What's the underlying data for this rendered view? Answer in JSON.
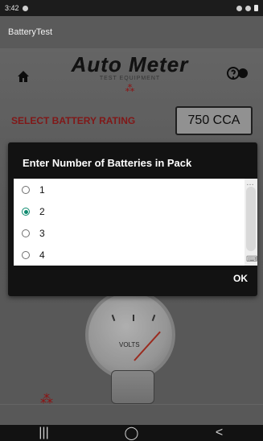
{
  "status_bar": {
    "time": "3:42",
    "icons": [
      "settings-icon",
      "notification-icon",
      "wifi-icon",
      "battery-icon"
    ]
  },
  "app_bar": {
    "title": "BatteryTest"
  },
  "header": {
    "logo_main": "Auto Meter",
    "logo_sub": "TEST EQUIPMENT",
    "left_icon": "home-icon",
    "right_icon": "help-icon"
  },
  "rating": {
    "label": "SELECT BATTERY RATING",
    "value": "750 CCA"
  },
  "dialog": {
    "title": "Enter Number of Batteries in Pack",
    "options": [
      "1",
      "2",
      "3",
      "4"
    ],
    "selected_index": 1,
    "ok_label": "OK"
  },
  "gauge": {
    "label": "VOLTS"
  },
  "nav": {
    "recent": "|||",
    "home": "◯",
    "back": "<"
  },
  "colors": {
    "accent": "#0e8a6f",
    "brand_red": "#b22222",
    "dialog_bg": "#121212"
  }
}
